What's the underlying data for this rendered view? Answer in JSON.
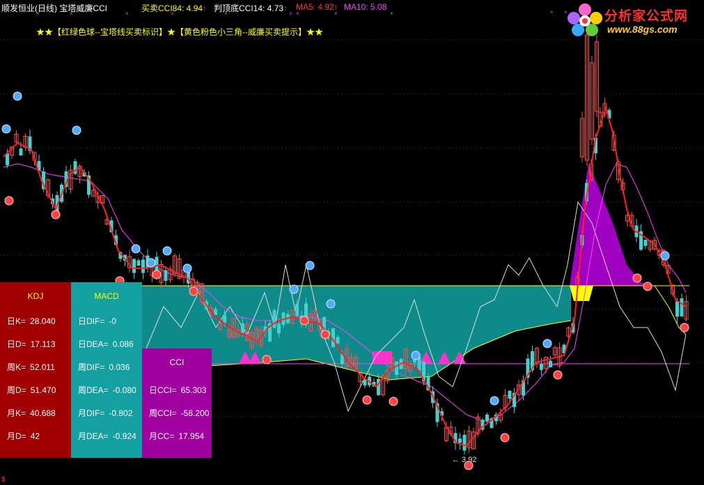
{
  "header": {
    "title": "顺发恒业(日线) 宝塔威廉CCI",
    "items": [
      {
        "label": "买卖CCI84: 4.94",
        "arrow": "↑",
        "color": "#ffff00"
      },
      {
        "label": "判顶底CCI14: 4.73",
        "arrow": "↑",
        "color": "#ffffff"
      },
      {
        "label": "MA5: 4.92",
        "arrow": "↑",
        "color": "#ff3030"
      },
      {
        "label": "MA10: 5.08",
        "arrow": "",
        "color": "#ff40ff"
      }
    ]
  },
  "banner": "★★【红绿色球--宝塔线买卖标识】★【黄色粉色小三角--威廉买卖提示】★★",
  "logo": {
    "text": "分析家公式网",
    "url": "www.88gs.com"
  },
  "panels": {
    "kdj": {
      "title": "KDJ",
      "rows": [
        {
          "label": "日K=",
          "value": "28.040"
        },
        {
          "label": "日D=",
          "value": "17.113"
        },
        {
          "label": "周K=",
          "value": "52.011"
        },
        {
          "label": "周D=",
          "value": "51.470"
        },
        {
          "label": "月K=",
          "value": "40.688"
        },
        {
          "label": "月D=",
          "value": "42"
        }
      ]
    },
    "macd": {
      "title": "MACD",
      "rows": [
        {
          "label": "日DIF=",
          "value": "-0"
        },
        {
          "label": "日DEA=",
          "value": "0.086"
        },
        {
          "label": "周DIF=",
          "value": "0.036"
        },
        {
          "label": "周DEA=",
          "value": "-0.080"
        },
        {
          "label": "月DIF=",
          "value": "-0.802"
        },
        {
          "label": "月DEA=",
          "value": "-0.924"
        }
      ]
    },
    "cci": {
      "title": "CCI",
      "rows": [
        {
          "label": "日CCI=",
          "value": "65.303"
        },
        {
          "label": "周CCI=",
          "value": "-58.200"
        },
        {
          "label": "月CC=",
          "value": "17.954"
        }
      ]
    }
  },
  "low_label": "← 3.92",
  "footer_symbol": "$",
  "colors": {
    "up": "#ff5050",
    "down": "#44d0d0",
    "ma5": "#ff2020",
    "ma10": "#ff40ff",
    "teal_fill": "#0f8a8a",
    "yellow_line": "#ffff00",
    "purple_fill": "#a000c0"
  }
}
